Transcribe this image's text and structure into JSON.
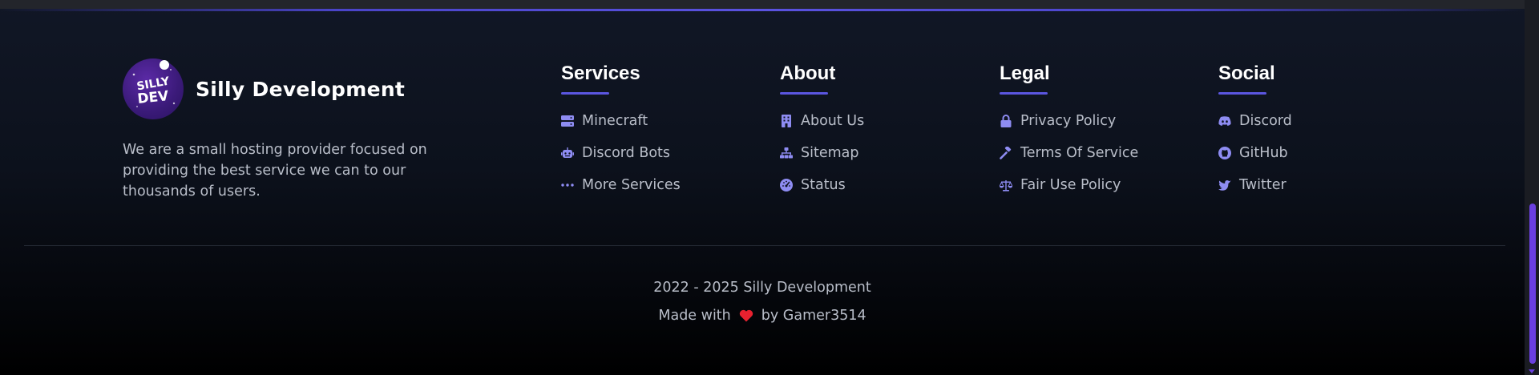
{
  "brand": {
    "name": "Silly Development",
    "logo_text_top": "SILLY",
    "logo_text_bottom": "DEV",
    "description": "We are a small hosting provider focused on providing the best service we can to our thousands of users."
  },
  "columns": [
    {
      "title": "Services",
      "items": [
        {
          "label": "Minecraft",
          "icon": "server-icon"
        },
        {
          "label": "Discord Bots",
          "icon": "robot-icon"
        },
        {
          "label": "More Services",
          "icon": "ellipsis-icon"
        }
      ]
    },
    {
      "title": "About",
      "items": [
        {
          "label": "About Us",
          "icon": "building-icon"
        },
        {
          "label": "Sitemap",
          "icon": "sitemap-icon"
        },
        {
          "label": "Status",
          "icon": "gauge-icon"
        }
      ]
    },
    {
      "title": "Legal",
      "items": [
        {
          "label": "Privacy Policy",
          "icon": "lock-icon"
        },
        {
          "label": "Terms Of Service",
          "icon": "gavel-icon"
        },
        {
          "label": "Fair Use Policy",
          "icon": "scale-icon"
        }
      ]
    },
    {
      "title": "Social",
      "items": [
        {
          "label": "Discord",
          "icon": "discord-icon"
        },
        {
          "label": "GitHub",
          "icon": "github-icon"
        },
        {
          "label": "Twitter",
          "icon": "twitter-icon"
        }
      ]
    }
  ],
  "footer": {
    "copyright": "2022 - 2025 Silly Development",
    "made_prefix": "Made with",
    "made_suffix": "by Gamer3514"
  },
  "colors": {
    "accent": "#5b56e0",
    "icon": "#8e8cf2",
    "text_muted": "#b9bec9",
    "heart": "#e8212f",
    "scrollbar": "#6a3fe0"
  }
}
